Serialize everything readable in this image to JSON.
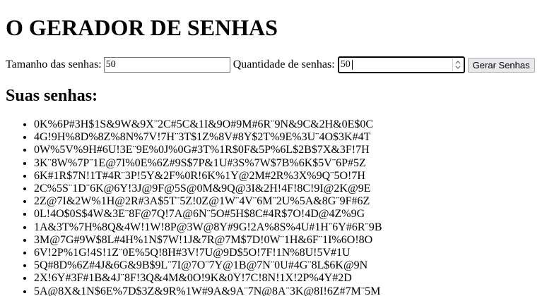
{
  "page": {
    "title": "O GERADOR DE SENHAS",
    "form": {
      "length_label": "Tamanho das senhas:",
      "length_value": "50",
      "quantity_label": "Quantidade de senhas:",
      "quantity_value": "50",
      "generate_label": "Gerar Senhas"
    },
    "results_heading": "Suas senhas:",
    "passwords": [
      "0K%6P#3H$1S&9W&9X¨2C#5C&1I&9O#9M#6R¨9N&9C&2H&0E$0C",
      "4G!9H%8D%8Z%8N%7V!7H¨3T$1Z%8V#8Y$2T%9E%3U¨4O$3K#4T",
      "0W%5V%9H#6U!3E¨9E%0J%0G#3T%1R$0F&5P%6L$2B$7X&3F!7H",
      "3K¨8W%7P¨1E@7I%0E%6Z#9S$7P&1U#3S%7W$7B%6K$5V¨6P#5Z",
      "6K#1R$7N!1T#4R¨3P!5Y&2F%0R!6K%1Y@2M#2R%3X%9Q¨5O!7H",
      "2C%5S¨1D¨6K@6Y!3J@9F@5S@0M&9Q@3I&2H!4F!8C!9I@2K@9E",
      "2Z@7I&2W%1H@2R#3A$5T¨5Z!0Z@1W¨4V¨6M¨2U%5A&8G¨9F#6Z",
      "0L!4O$0S$4W&3E¨8F@7Q!7A@6N¨5O#5H$8C#4R$7O!4D@4Z%9G",
      "1A&3T%7H%8Q&4W!1W!8P@3W@8Y#9G!2A%8S%4U#1H¨6Y#6R¨9B",
      "3M@7G#9W$8L#4H%1N$7W!1J&7R@7M$7D!0W¨1H&6F¨1I%6O!8O",
      "6V!2P%1G!4S!1Z¨0E%5Q!8H#3V!7U@9D$5O!7F!1N%8U!5V#1U",
      "5Q#8D%6Z#4J&6G&9B$9L¨7I@7O¨7Y@1B@7N¨0U#4G¨8L$6K@9N",
      "2X!6Y#3F#1B&4J¨8F!3Q&4M&0O!9K&0Y!7C!8N!1X!2P%4Y#2D",
      "5A@8X&1N$6E%7D$3Z&9R%1W#9A&9A¨7N@8A¨3K@8I!6Z#7M¨5M"
    ]
  }
}
